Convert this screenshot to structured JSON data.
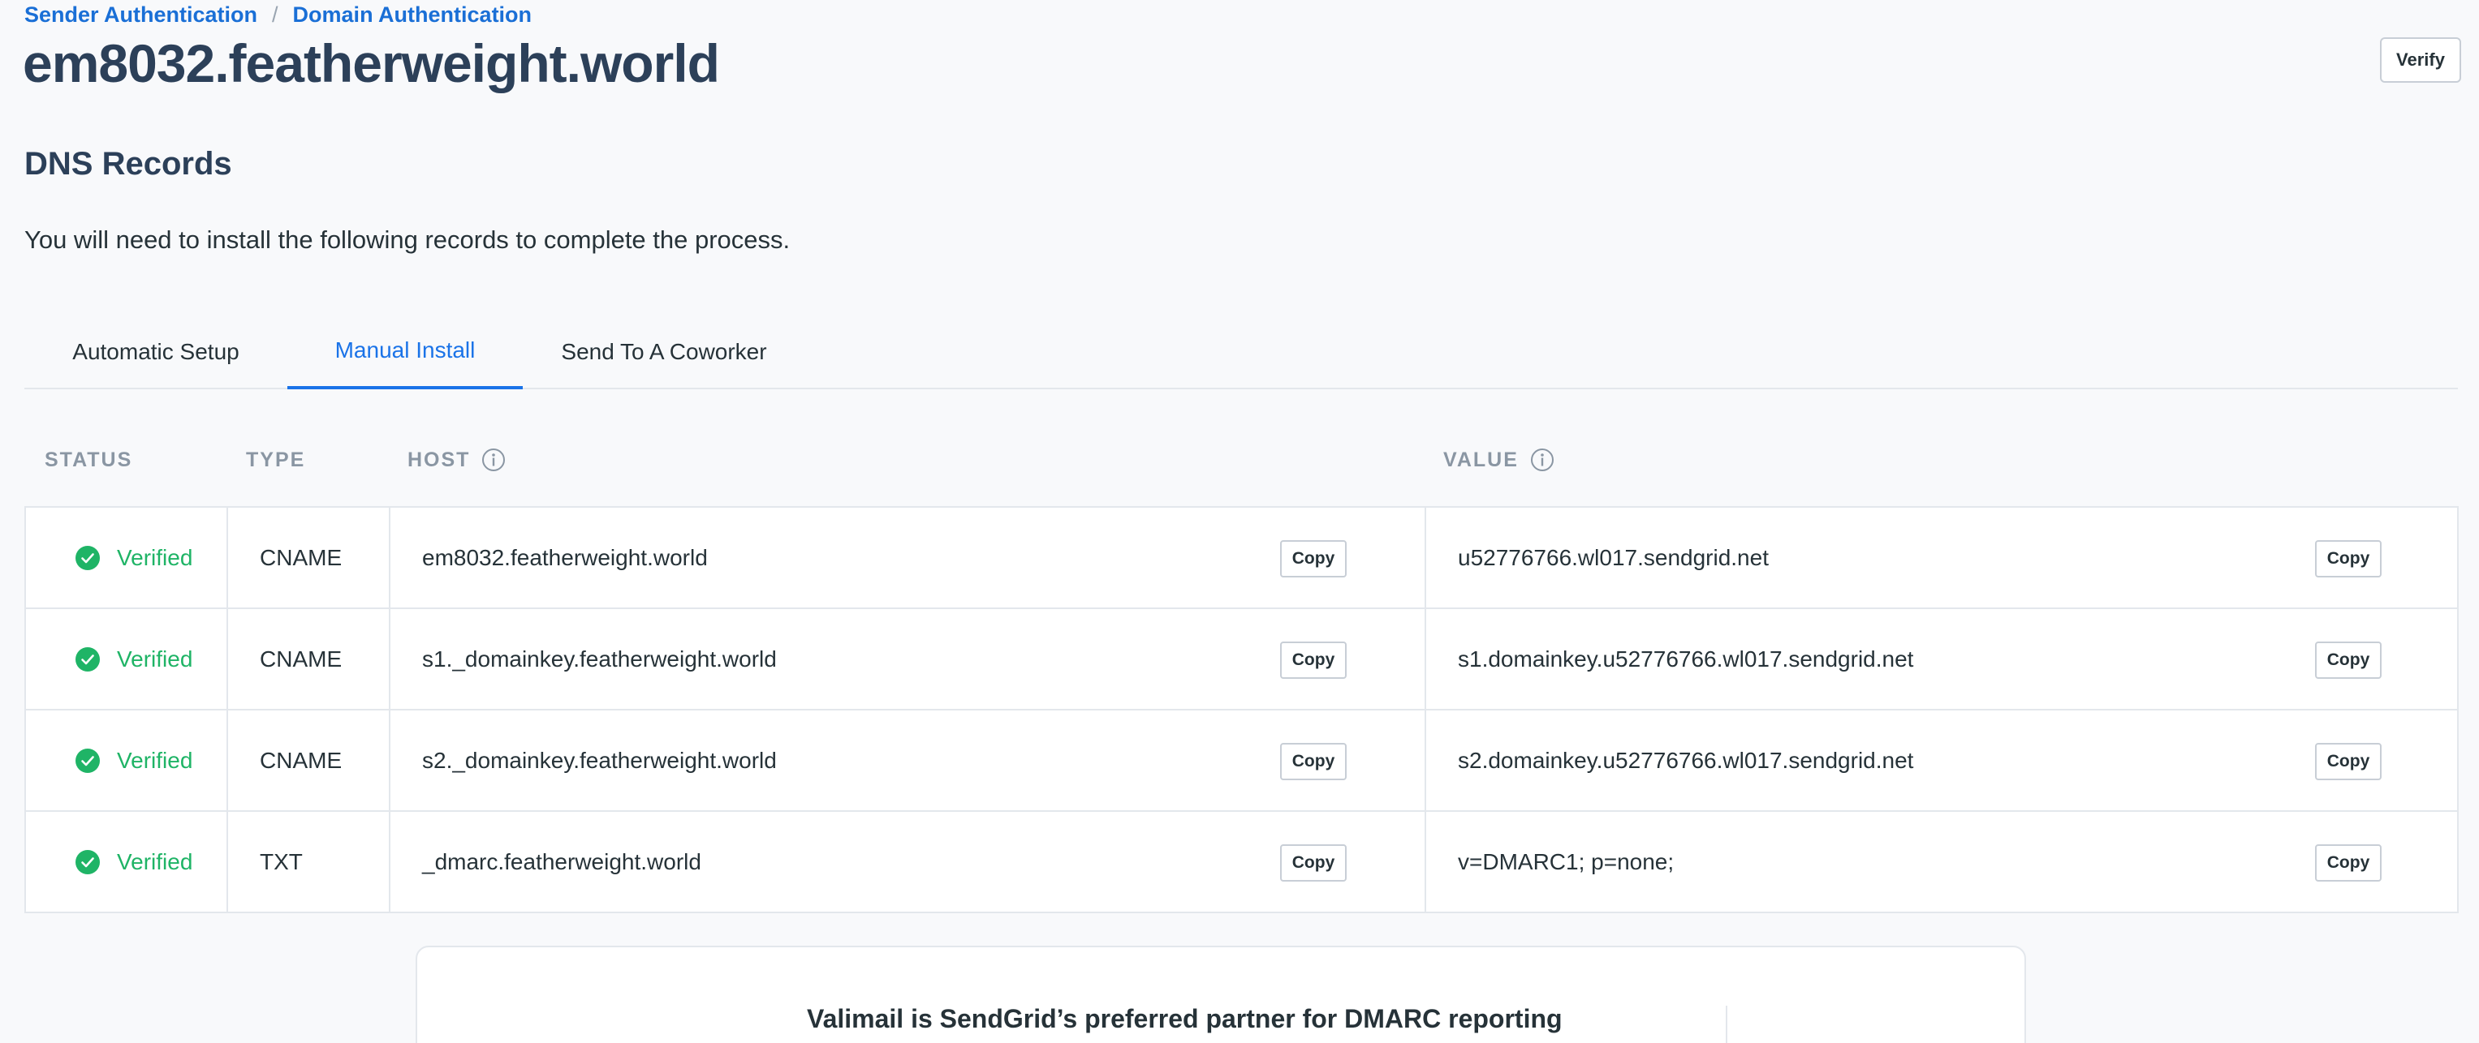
{
  "breadcrumb": {
    "items": [
      "Sender Authentication",
      "Domain Authentication"
    ],
    "separator": "/"
  },
  "header": {
    "title": "em8032.featherweight.world",
    "verify_label": "Verify"
  },
  "dns": {
    "section_title": "DNS Records",
    "description": "You will need to install the following records to complete the process."
  },
  "tabs": [
    {
      "label": "Automatic Setup",
      "active": false
    },
    {
      "label": "Manual Install",
      "active": true
    },
    {
      "label": "Send To A Coworker",
      "active": false
    }
  ],
  "table": {
    "columns": {
      "status": "STATUS",
      "type": "TYPE",
      "host": "HOST",
      "value": "VALUE"
    },
    "copy_label": "Copy",
    "rows": [
      {
        "status": "Verified",
        "type": "CNAME",
        "host": "em8032.featherweight.world",
        "value": "u52776766.wl017.sendgrid.net"
      },
      {
        "status": "Verified",
        "type": "CNAME",
        "host": "s1._domainkey.featherweight.world",
        "value": "s1.domainkey.u52776766.wl017.sendgrid.net"
      },
      {
        "status": "Verified",
        "type": "CNAME",
        "host": "s2._domainkey.featherweight.world",
        "value": "s2.domainkey.u52776766.wl017.sendgrid.net"
      },
      {
        "status": "Verified",
        "type": "TXT",
        "host": "_dmarc.featherweight.world",
        "value": "v=DMARC1; p=none;"
      }
    ]
  },
  "partner": {
    "title": "Valimail is SendGrid’s preferred partner for DMARC reporting"
  },
  "colors": {
    "link": "#1a73e8",
    "title": "#2c4059",
    "verified": "#1fb466",
    "border": "#e3e7ec"
  },
  "icons": {
    "status": "check-circle-icon",
    "info": "info-icon"
  }
}
